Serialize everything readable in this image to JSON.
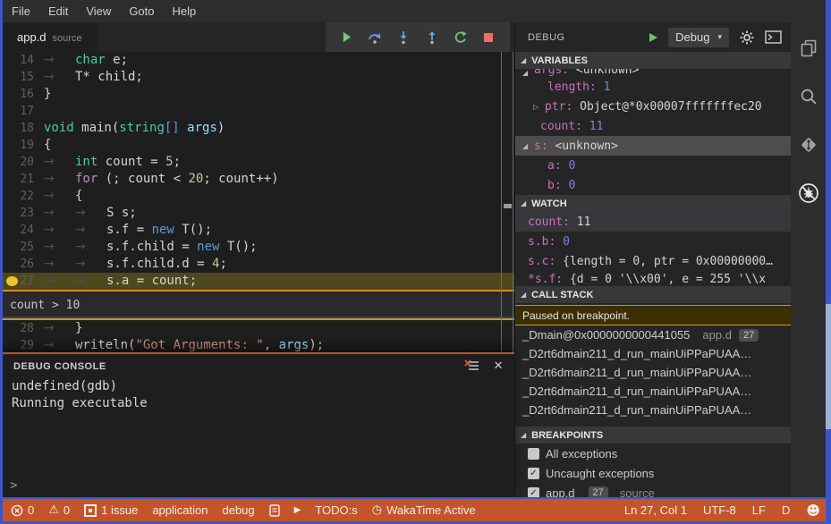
{
  "palette": {
    "window_border": "#3F55C5",
    "statusbar_bg": "#C4552B",
    "editor_bg": "#1E1E1E",
    "panel_bg": "#252526",
    "chrome_bg": "#2D2D2D",
    "tabbar_bg": "#252526",
    "toolbar_bg": "#363636",
    "section_header_bg": "#38383A",
    "accent_orange": "#D98E1F",
    "console_accent": "#BF5620",
    "current_line_bg": "#4F481E",
    "breakpoint_color": "#EFC32D",
    "selected_row_bg": "#4D4D4D",
    "paused_bg": "#3B2E00",
    "paused_border": "#C9A100",
    "var_name": "#CC6FBB"
  },
  "menubar": {
    "items": [
      "File",
      "Edit",
      "View",
      "Goto",
      "Help"
    ]
  },
  "editor": {
    "tab": {
      "name": "app.d",
      "hint": "source"
    },
    "toolbar": [
      {
        "icon": "continue"
      },
      {
        "icon": "step-over"
      },
      {
        "icon": "step-into"
      },
      {
        "icon": "step-out"
      },
      {
        "icon": "restart"
      },
      {
        "icon": "stop"
      }
    ],
    "breakpoint_line": 27,
    "current_line": 27,
    "peek_condition": "count > 10",
    "lines": [
      {
        "n": 14,
        "ind": 1,
        "tok": [
          [
            "kw",
            "char"
          ],
          [
            "pl",
            " e;"
          ]
        ]
      },
      {
        "n": 15,
        "ind": 1,
        "tok": [
          [
            "pl",
            "T* child;"
          ]
        ]
      },
      {
        "n": 16,
        "ind": 0,
        "tok": [
          [
            "pl",
            "}"
          ]
        ]
      },
      {
        "n": 17,
        "ind": 0,
        "tok": []
      },
      {
        "n": 18,
        "ind": 0,
        "tok": [
          [
            "kw",
            "void"
          ],
          [
            "pl",
            " main("
          ],
          [
            "kw",
            "string"
          ],
          [
            "newkw",
            "[]"
          ],
          [
            "pl",
            " "
          ],
          [
            "param",
            "args"
          ],
          [
            "pl",
            ")"
          ]
        ]
      },
      {
        "n": 19,
        "ind": 0,
        "tok": [
          [
            "pl",
            "{"
          ]
        ]
      },
      {
        "n": 20,
        "ind": 1,
        "tok": [
          [
            "kw",
            "int"
          ],
          [
            "pl",
            " count = "
          ],
          [
            "num",
            "5"
          ],
          [
            "pl",
            ";"
          ]
        ]
      },
      {
        "n": 21,
        "ind": 1,
        "tok": [
          [
            "ctrl",
            "for"
          ],
          [
            "pl",
            " (; count < "
          ],
          [
            "num",
            "20"
          ],
          [
            "pl",
            "; count++)"
          ]
        ]
      },
      {
        "n": 22,
        "ind": 1,
        "tok": [
          [
            "pl",
            "{"
          ]
        ]
      },
      {
        "n": 23,
        "ind": 2,
        "tok": [
          [
            "pl",
            "S s;"
          ]
        ]
      },
      {
        "n": 24,
        "ind": 2,
        "tok": [
          [
            "pl",
            "s.f = "
          ],
          [
            "newkw",
            "new"
          ],
          [
            "pl",
            " T();"
          ]
        ]
      },
      {
        "n": 25,
        "ind": 2,
        "tok": [
          [
            "pl",
            "s.f.child = "
          ],
          [
            "newkw",
            "new"
          ],
          [
            "pl",
            " T();"
          ]
        ]
      },
      {
        "n": 26,
        "ind": 2,
        "tok": [
          [
            "pl",
            "s.f.child.d = "
          ],
          [
            "num",
            "4"
          ],
          [
            "pl",
            ";"
          ]
        ]
      },
      {
        "n": 27,
        "ind": 2,
        "tok": [
          [
            "pl",
            "s.a = count;"
          ]
        ]
      },
      {
        "n": 28,
        "ind": 1,
        "tok": [
          [
            "pl",
            "}"
          ]
        ]
      },
      {
        "n": 29,
        "ind": 1,
        "tok": [
          [
            "pl",
            "writeln("
          ],
          [
            "str",
            "\"Got Arguments: \""
          ],
          [
            "pl",
            ", "
          ],
          [
            "param",
            "args"
          ],
          [
            "pl",
            ");"
          ]
        ]
      }
    ]
  },
  "console": {
    "title": "DEBUG CONSOLE",
    "lines": [
      "undefined(gdb)",
      "Running executable"
    ],
    "prompt": ">"
  },
  "debug_panel": {
    "title": "DEBUG",
    "config": "Debug",
    "sections": {
      "variables": "VARIABLES",
      "watch": "WATCH",
      "call_stack": "CALL STACK",
      "breakpoints": "BREAKPOINTS"
    },
    "variables": [
      {
        "name": "args",
        "value": "<unknown>",
        "vtype": "plain",
        "expand": "open",
        "indent": 1,
        "clipped": true
      },
      {
        "name": "length",
        "value": "1",
        "vtype": "num",
        "indent": 2
      },
      {
        "name": "ptr",
        "value": "Object@*0x00007fffffffec20",
        "vtype": "plain",
        "expand": "closed",
        "indent": 2
      },
      {
        "name": "count",
        "value": "11",
        "vtype": "num",
        "indent": 1
      },
      {
        "name": "s",
        "value": "<unknown>",
        "vtype": "plain",
        "expand": "open",
        "indent": 1,
        "selected": true
      },
      {
        "name": "a",
        "value": "0",
        "vtype": "num",
        "indent": 2
      },
      {
        "name": "b",
        "value": "0",
        "vtype": "num",
        "indent": 2
      }
    ],
    "watch": [
      {
        "name": "count",
        "value": "11",
        "vtype": "plain",
        "highlight": true
      },
      {
        "name": "s.b",
        "value": "0",
        "vtype": "num"
      },
      {
        "name": "s.c",
        "value": "{length = 0, ptr = 0x00000000…",
        "vtype": "plain"
      },
      {
        "name": "*s.f",
        "value": "{d = 0 '\\\\x00', e = 255 '\\\\x",
        "vtype": "plain",
        "clipped": true
      }
    ],
    "call_stack": {
      "status": "Paused on breakpoint.",
      "frames": [
        {
          "label": "_Dmain@0x0000000000441055",
          "file": "app.d",
          "line": "27"
        },
        {
          "label": "_D2rt6dmain211_d_run_mainUiPPaPUAA…"
        },
        {
          "label": "_D2rt6dmain211_d_run_mainUiPPaPUAA…"
        },
        {
          "label": "_D2rt6dmain211_d_run_mainUiPPaPUAA…"
        },
        {
          "label": "_D2rt6dmain211_d_run_mainUiPPaPUAA…"
        }
      ]
    },
    "breakpoints": [
      {
        "checked": false,
        "label": "All exceptions"
      },
      {
        "checked": true,
        "label": "Uncaught exceptions"
      },
      {
        "checked": true,
        "label": "app.d",
        "badge": "27",
        "hint": "source"
      }
    ]
  },
  "activity_bar": [
    {
      "icon": "files"
    },
    {
      "icon": "search"
    },
    {
      "icon": "source-control"
    },
    {
      "icon": "debug-off",
      "active": true
    }
  ],
  "status_bar": {
    "left": [
      {
        "icon": "error",
        "text": "0"
      },
      {
        "icon": "warning",
        "text": "0"
      },
      {
        "icon": "issues",
        "text": "1 issue"
      },
      {
        "text": "application"
      },
      {
        "text": "debug"
      },
      {
        "icon": "file"
      },
      {
        "icon": "play"
      },
      {
        "text": "TODO:s"
      },
      {
        "icon": "clock",
        "text": "WakaTime Active"
      }
    ],
    "right": [
      {
        "text": "Ln 27, Col 1"
      },
      {
        "text": "UTF-8"
      },
      {
        "text": "LF"
      },
      {
        "text": "D"
      },
      {
        "icon": "smiley"
      }
    ]
  }
}
